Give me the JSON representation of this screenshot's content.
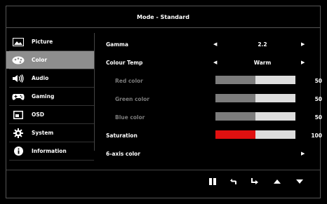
{
  "title": "Mode - Standard",
  "sidebar": {
    "items": [
      {
        "label": "Picture",
        "icon": "picture-icon"
      },
      {
        "label": "Color",
        "icon": "palette-icon",
        "active": true
      },
      {
        "label": "Audio",
        "icon": "speaker-icon"
      },
      {
        "label": "Gaming",
        "icon": "gamepad-icon"
      },
      {
        "label": "OSD",
        "icon": "osd-icon"
      },
      {
        "label": "System",
        "icon": "gear-icon"
      },
      {
        "label": "Information",
        "icon": "info-icon"
      }
    ]
  },
  "settings": {
    "gamma": {
      "label": "Gamma",
      "value": "2.2"
    },
    "colour_temp": {
      "label": "Colour Temp",
      "value": "Warm"
    },
    "red": {
      "label": "Red color",
      "value": "50",
      "level": 0.5
    },
    "green": {
      "label": "Green color",
      "value": "50",
      "level": 0.5
    },
    "blue": {
      "label": "Blue color",
      "value": "50",
      "level": 0.5
    },
    "saturation": {
      "label": "Saturation",
      "value": "100",
      "level": 0.5
    },
    "six_axis": {
      "label": "6-axis color"
    }
  },
  "colors": {
    "active_bg": "#8e8e8e",
    "saturation_fill": "#e01010",
    "slider_fill": "#7c7c7c"
  },
  "bottom_buttons": [
    "pause-icon",
    "back-icon",
    "enter-icon",
    "up-icon",
    "down-icon"
  ]
}
